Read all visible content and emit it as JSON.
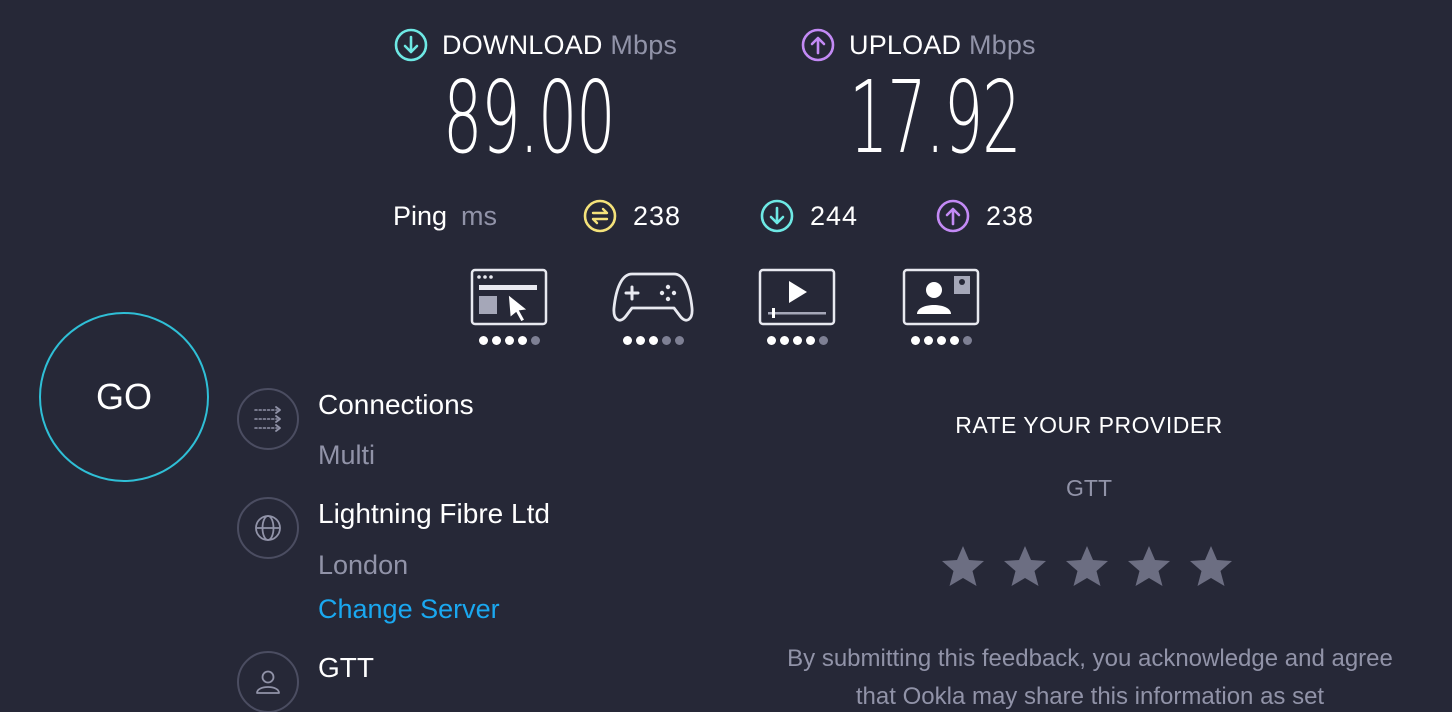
{
  "results": {
    "download": {
      "label": "DOWNLOAD",
      "unit": "Mbps",
      "value": "89.00",
      "icon": "download-arrow-icon",
      "color": "#6ee8e4"
    },
    "upload": {
      "label": "UPLOAD",
      "unit": "Mbps",
      "value": "17.92",
      "icon": "upload-arrow-icon",
      "color": "#c38af5"
    }
  },
  "ping": {
    "label": "Ping",
    "unit": "ms",
    "idle": {
      "value": "238",
      "icon": "idle-latency-icon",
      "color": "#f4e27a"
    },
    "download": {
      "value": "244",
      "icon": "download-latency-icon",
      "color": "#6ee8e4"
    },
    "upload": {
      "value": "238",
      "icon": "upload-latency-icon",
      "color": "#c38af5"
    }
  },
  "activities": [
    {
      "name": "web-browsing",
      "icon": "browser-cursor-icon",
      "rating": 4,
      "max": 5
    },
    {
      "name": "gaming",
      "icon": "game-controller-icon",
      "rating": 3,
      "max": 5
    },
    {
      "name": "video-streaming",
      "icon": "video-play-icon",
      "rating": 4,
      "max": 5
    },
    {
      "name": "video-chat",
      "icon": "video-call-icon",
      "rating": 4,
      "max": 5
    }
  ],
  "go_button": {
    "label": "GO"
  },
  "connections": {
    "title": "Connections",
    "value": "Multi",
    "icon": "connections-arrows-icon"
  },
  "server": {
    "title": "Lightning Fibre Ltd",
    "location": "London",
    "change_label": "Change Server",
    "icon": "globe-icon"
  },
  "provider": {
    "title": "GTT",
    "icon": "user-icon"
  },
  "rate": {
    "title": "RATE YOUR PROVIDER",
    "provider": "GTT",
    "stars": 5,
    "selected": 0,
    "disclaimer": "By submitting this feedback, you acknowledge and agree that Ookla may share this information as set"
  },
  "colors": {
    "background": "#262837",
    "go_ring": "#2fbfd6",
    "link": "#1aa8f0",
    "muted_text": "#9193a8",
    "star": "#6c6e82"
  }
}
